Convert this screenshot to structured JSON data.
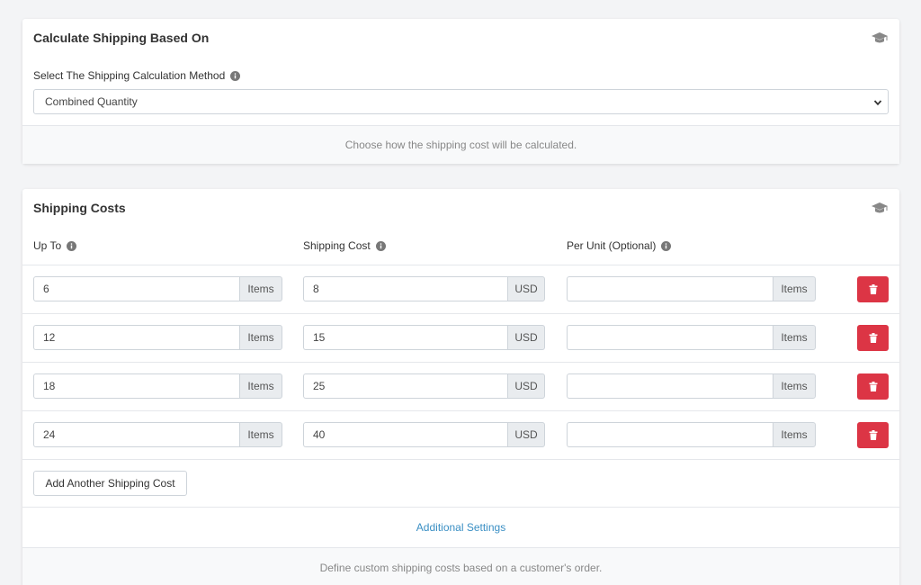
{
  "calculation": {
    "title": "Calculate Shipping Based On",
    "method_label": "Select The Shipping Calculation Method",
    "method_value": "Combined Quantity",
    "help_text": "Choose how the shipping cost will be calculated."
  },
  "shipping_costs": {
    "title": "Shipping Costs",
    "columns": {
      "up_to": "Up To",
      "shipping_cost": "Shipping Cost",
      "per_unit": "Per Unit (Optional)"
    },
    "rows": [
      {
        "up_to": "6",
        "up_to_unit": "Items",
        "cost": "8",
        "cost_unit": "USD",
        "per_unit": "",
        "per_unit_unit": "Items"
      },
      {
        "up_to": "12",
        "up_to_unit": "Items",
        "cost": "15",
        "cost_unit": "USD",
        "per_unit": "",
        "per_unit_unit": "Items"
      },
      {
        "up_to": "18",
        "up_to_unit": "Items",
        "cost": "25",
        "cost_unit": "USD",
        "per_unit": "",
        "per_unit_unit": "Items"
      },
      {
        "up_to": "24",
        "up_to_unit": "Items",
        "cost": "40",
        "cost_unit": "USD",
        "per_unit": "",
        "per_unit_unit": "Items"
      }
    ],
    "add_button": "Add Another Shipping Cost",
    "additional_settings": "Additional Settings",
    "help_text": "Define custom shipping costs based on a customer's order."
  },
  "icons": {
    "tutorial": "graduation-cap-icon",
    "info": "info-circle-icon",
    "delete": "trash-icon",
    "dropdown": "chevron-down-icon"
  },
  "colors": {
    "danger": "#dc3545",
    "link": "#3a8fc4",
    "page_bg": "#f3f4f6"
  }
}
